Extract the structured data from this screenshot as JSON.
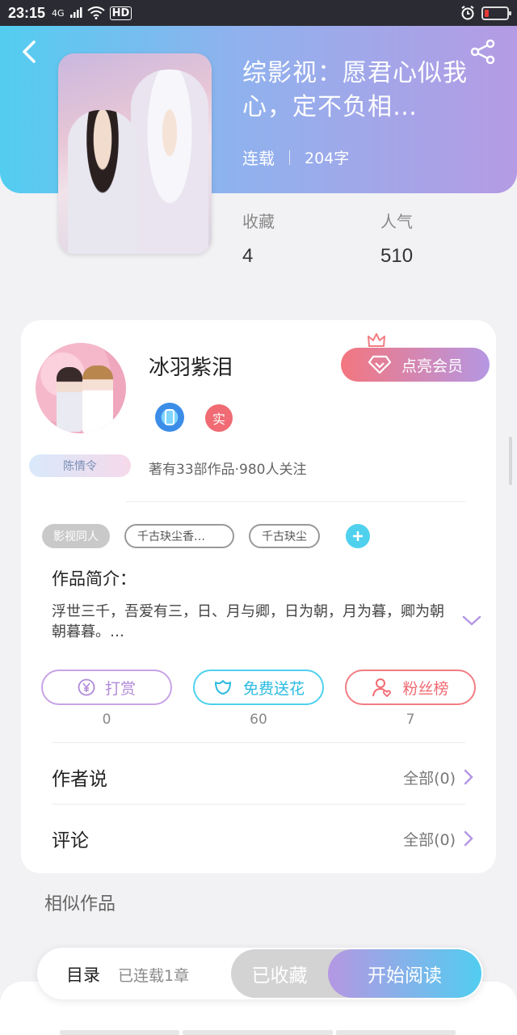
{
  "status_bar": {
    "time": "23:15",
    "network": "4G",
    "hd": "HD"
  },
  "header": {
    "title": "综影视：愿君心似我心，定不负相…",
    "status": "连载",
    "word_count": "204字"
  },
  "stats": {
    "favorites_label": "收藏",
    "favorites_value": "4",
    "popularity_label": "人气",
    "popularity_value": "510"
  },
  "author": {
    "name": "冰羽紫泪",
    "tag": "陈情令",
    "badge_real": "实",
    "summary": "著有33部作品·980人关注",
    "vip_button": "点亮会员"
  },
  "tags": [
    "影视同人",
    "千古玦尘香…",
    "千古玦尘"
  ],
  "intro": {
    "heading": "作品简介：",
    "text": "浮世三千，吾爱有三，日、月与卿，日为朝，月为暮，卿为朝朝暮暮。…"
  },
  "actions": [
    {
      "label": "打赏",
      "count": "0",
      "icon": "yen-icon"
    },
    {
      "label": "免费送花",
      "count": "60",
      "icon": "flower-icon"
    },
    {
      "label": "粉丝榜",
      "count": "7",
      "icon": "user-heart-icon"
    }
  ],
  "rows": {
    "author_says": {
      "label": "作者说",
      "link": "全部(0)"
    },
    "comments": {
      "label": "评论",
      "link": "全部(0)"
    }
  },
  "similar_heading": "相似作品",
  "bottom": {
    "toc": "目录",
    "toc_sub": "已连载1章",
    "favorited": "已收藏",
    "start_read": "开始阅读"
  },
  "colors": {
    "accent_cyan": "#52cdf0",
    "accent_purple": "#b597e3",
    "accent_red": "#f06a72"
  }
}
